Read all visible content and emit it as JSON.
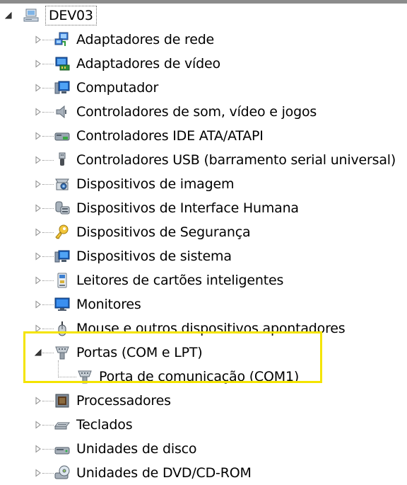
{
  "root": {
    "label": "DEV03",
    "icon": "computer-icon",
    "expanded": true
  },
  "categories": [
    {
      "label": "Adaptadores de rede",
      "icon": "network-adapter-icon",
      "expanded": false
    },
    {
      "label": "Adaptadores de vídeo",
      "icon": "display-adapter-icon",
      "expanded": false
    },
    {
      "label": "Computador",
      "icon": "computer-monitor-icon",
      "expanded": false
    },
    {
      "label": "Controladores de som, vídeo e jogos",
      "icon": "speaker-icon",
      "expanded": false
    },
    {
      "label": "Controladores IDE ATA/ATAPI",
      "icon": "ide-controller-icon",
      "expanded": false
    },
    {
      "label": "Controladores USB (barramento serial universal)",
      "icon": "usb-icon",
      "expanded": false
    },
    {
      "label": "Dispositivos de imagem",
      "icon": "camera-icon",
      "expanded": false
    },
    {
      "label": "Dispositivos de Interface Humana",
      "icon": "hid-icon",
      "expanded": false
    },
    {
      "label": "Dispositivos de Segurança",
      "icon": "security-key-icon",
      "expanded": false
    },
    {
      "label": "Dispositivos de sistema",
      "icon": "system-device-icon",
      "expanded": false
    },
    {
      "label": "Leitores de cartões inteligentes",
      "icon": "smart-card-icon",
      "expanded": false
    },
    {
      "label": "Monitores",
      "icon": "monitor-icon",
      "expanded": false
    },
    {
      "label": "Mouse e outros dispositivos apontadores",
      "icon": "mouse-icon",
      "expanded": false
    },
    {
      "label": "Portas (COM e LPT)",
      "icon": "port-icon",
      "expanded": true,
      "children": [
        {
          "label": "Porta de comunicação (COM1)",
          "icon": "port-icon"
        }
      ]
    },
    {
      "label": "Processadores",
      "icon": "processor-icon",
      "expanded": false
    },
    {
      "label": "Teclados",
      "icon": "keyboard-icon",
      "expanded": false
    },
    {
      "label": "Unidades de disco",
      "icon": "disk-drive-icon",
      "expanded": false
    },
    {
      "label": "Unidades de DVD/CD-ROM",
      "icon": "dvd-drive-icon",
      "expanded": false
    }
  ],
  "colors": {
    "highlight": "#f4e400",
    "tree_lines": "#a0a0a0"
  }
}
